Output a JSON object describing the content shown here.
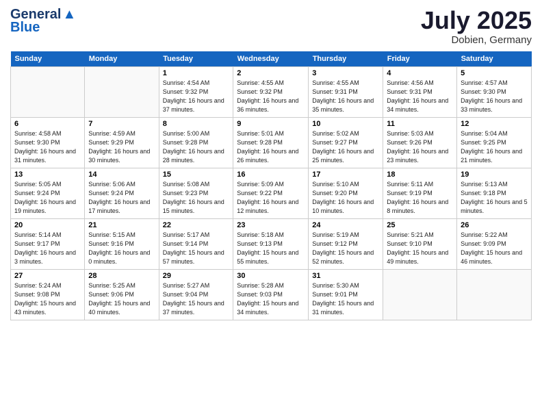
{
  "header": {
    "logo_line1": "General",
    "logo_line2": "Blue",
    "month_year": "July 2025",
    "location": "Dobien, Germany"
  },
  "days_of_week": [
    "Sunday",
    "Monday",
    "Tuesday",
    "Wednesday",
    "Thursday",
    "Friday",
    "Saturday"
  ],
  "weeks": [
    [
      {
        "day": "",
        "sunrise": "",
        "sunset": "",
        "daylight": ""
      },
      {
        "day": "",
        "sunrise": "",
        "sunset": "",
        "daylight": ""
      },
      {
        "day": "1",
        "sunrise": "Sunrise: 4:54 AM",
        "sunset": "Sunset: 9:32 PM",
        "daylight": "Daylight: 16 hours and 37 minutes."
      },
      {
        "day": "2",
        "sunrise": "Sunrise: 4:55 AM",
        "sunset": "Sunset: 9:32 PM",
        "daylight": "Daylight: 16 hours and 36 minutes."
      },
      {
        "day": "3",
        "sunrise": "Sunrise: 4:55 AM",
        "sunset": "Sunset: 9:31 PM",
        "daylight": "Daylight: 16 hours and 35 minutes."
      },
      {
        "day": "4",
        "sunrise": "Sunrise: 4:56 AM",
        "sunset": "Sunset: 9:31 PM",
        "daylight": "Daylight: 16 hours and 34 minutes."
      },
      {
        "day": "5",
        "sunrise": "Sunrise: 4:57 AM",
        "sunset": "Sunset: 9:30 PM",
        "daylight": "Daylight: 16 hours and 33 minutes."
      }
    ],
    [
      {
        "day": "6",
        "sunrise": "Sunrise: 4:58 AM",
        "sunset": "Sunset: 9:30 PM",
        "daylight": "Daylight: 16 hours and 31 minutes."
      },
      {
        "day": "7",
        "sunrise": "Sunrise: 4:59 AM",
        "sunset": "Sunset: 9:29 PM",
        "daylight": "Daylight: 16 hours and 30 minutes."
      },
      {
        "day": "8",
        "sunrise": "Sunrise: 5:00 AM",
        "sunset": "Sunset: 9:28 PM",
        "daylight": "Daylight: 16 hours and 28 minutes."
      },
      {
        "day": "9",
        "sunrise": "Sunrise: 5:01 AM",
        "sunset": "Sunset: 9:28 PM",
        "daylight": "Daylight: 16 hours and 26 minutes."
      },
      {
        "day": "10",
        "sunrise": "Sunrise: 5:02 AM",
        "sunset": "Sunset: 9:27 PM",
        "daylight": "Daylight: 16 hours and 25 minutes."
      },
      {
        "day": "11",
        "sunrise": "Sunrise: 5:03 AM",
        "sunset": "Sunset: 9:26 PM",
        "daylight": "Daylight: 16 hours and 23 minutes."
      },
      {
        "day": "12",
        "sunrise": "Sunrise: 5:04 AM",
        "sunset": "Sunset: 9:25 PM",
        "daylight": "Daylight: 16 hours and 21 minutes."
      }
    ],
    [
      {
        "day": "13",
        "sunrise": "Sunrise: 5:05 AM",
        "sunset": "Sunset: 9:24 PM",
        "daylight": "Daylight: 16 hours and 19 minutes."
      },
      {
        "day": "14",
        "sunrise": "Sunrise: 5:06 AM",
        "sunset": "Sunset: 9:24 PM",
        "daylight": "Daylight: 16 hours and 17 minutes."
      },
      {
        "day": "15",
        "sunrise": "Sunrise: 5:08 AM",
        "sunset": "Sunset: 9:23 PM",
        "daylight": "Daylight: 16 hours and 15 minutes."
      },
      {
        "day": "16",
        "sunrise": "Sunrise: 5:09 AM",
        "sunset": "Sunset: 9:22 PM",
        "daylight": "Daylight: 16 hours and 12 minutes."
      },
      {
        "day": "17",
        "sunrise": "Sunrise: 5:10 AM",
        "sunset": "Sunset: 9:20 PM",
        "daylight": "Daylight: 16 hours and 10 minutes."
      },
      {
        "day": "18",
        "sunrise": "Sunrise: 5:11 AM",
        "sunset": "Sunset: 9:19 PM",
        "daylight": "Daylight: 16 hours and 8 minutes."
      },
      {
        "day": "19",
        "sunrise": "Sunrise: 5:13 AM",
        "sunset": "Sunset: 9:18 PM",
        "daylight": "Daylight: 16 hours and 5 minutes."
      }
    ],
    [
      {
        "day": "20",
        "sunrise": "Sunrise: 5:14 AM",
        "sunset": "Sunset: 9:17 PM",
        "daylight": "Daylight: 16 hours and 3 minutes."
      },
      {
        "day": "21",
        "sunrise": "Sunrise: 5:15 AM",
        "sunset": "Sunset: 9:16 PM",
        "daylight": "Daylight: 16 hours and 0 minutes."
      },
      {
        "day": "22",
        "sunrise": "Sunrise: 5:17 AM",
        "sunset": "Sunset: 9:14 PM",
        "daylight": "Daylight: 15 hours and 57 minutes."
      },
      {
        "day": "23",
        "sunrise": "Sunrise: 5:18 AM",
        "sunset": "Sunset: 9:13 PM",
        "daylight": "Daylight: 15 hours and 55 minutes."
      },
      {
        "day": "24",
        "sunrise": "Sunrise: 5:19 AM",
        "sunset": "Sunset: 9:12 PM",
        "daylight": "Daylight: 15 hours and 52 minutes."
      },
      {
        "day": "25",
        "sunrise": "Sunrise: 5:21 AM",
        "sunset": "Sunset: 9:10 PM",
        "daylight": "Daylight: 15 hours and 49 minutes."
      },
      {
        "day": "26",
        "sunrise": "Sunrise: 5:22 AM",
        "sunset": "Sunset: 9:09 PM",
        "daylight": "Daylight: 15 hours and 46 minutes."
      }
    ],
    [
      {
        "day": "27",
        "sunrise": "Sunrise: 5:24 AM",
        "sunset": "Sunset: 9:08 PM",
        "daylight": "Daylight: 15 hours and 43 minutes."
      },
      {
        "day": "28",
        "sunrise": "Sunrise: 5:25 AM",
        "sunset": "Sunset: 9:06 PM",
        "daylight": "Daylight: 15 hours and 40 minutes."
      },
      {
        "day": "29",
        "sunrise": "Sunrise: 5:27 AM",
        "sunset": "Sunset: 9:04 PM",
        "daylight": "Daylight: 15 hours and 37 minutes."
      },
      {
        "day": "30",
        "sunrise": "Sunrise: 5:28 AM",
        "sunset": "Sunset: 9:03 PM",
        "daylight": "Daylight: 15 hours and 34 minutes."
      },
      {
        "day": "31",
        "sunrise": "Sunrise: 5:30 AM",
        "sunset": "Sunset: 9:01 PM",
        "daylight": "Daylight: 15 hours and 31 minutes."
      },
      {
        "day": "",
        "sunrise": "",
        "sunset": "",
        "daylight": ""
      },
      {
        "day": "",
        "sunrise": "",
        "sunset": "",
        "daylight": ""
      }
    ]
  ]
}
